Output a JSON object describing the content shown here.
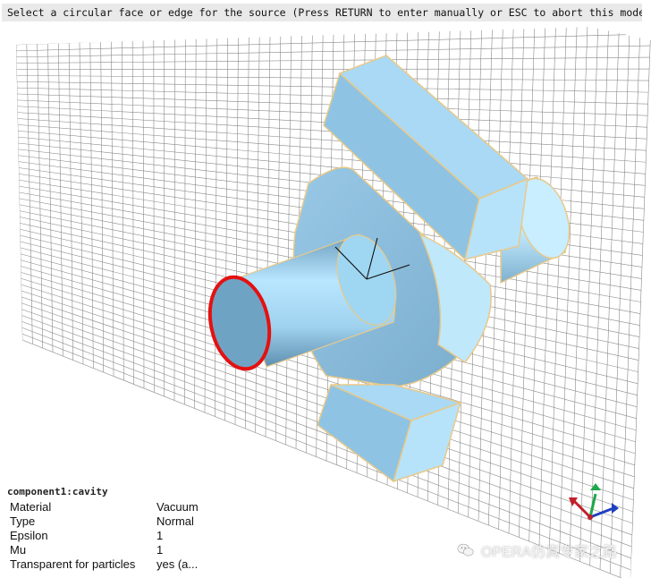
{
  "status": {
    "message": "Select a circular face or edge for the source (Press RETURN to enter manually or ESC to abort this mode)"
  },
  "properties": {
    "title": "component1:cavity",
    "rows": [
      {
        "key": "Material",
        "value": "Vacuum"
      },
      {
        "key": "Type",
        "value": "Normal"
      },
      {
        "key": "Epsilon",
        "value": "1"
      },
      {
        "key": "Mu",
        "value": "1"
      },
      {
        "key": "Transparent for particles",
        "value": "yes (a..."
      }
    ]
  },
  "watermark": {
    "text": "OPERA仿真专家之路"
  },
  "colors": {
    "body_fill": "#a9d9f4",
    "body_dark": "#7fb6d6",
    "edge": "#e8c98a",
    "selection": "#e41111",
    "grid": "#7a7a7a",
    "axis_x": "#c0202a",
    "axis_y": "#1ea84a",
    "axis_z": "#2040c0"
  },
  "icons": [
    "wechat-icon",
    "axis-triad-icon"
  ]
}
